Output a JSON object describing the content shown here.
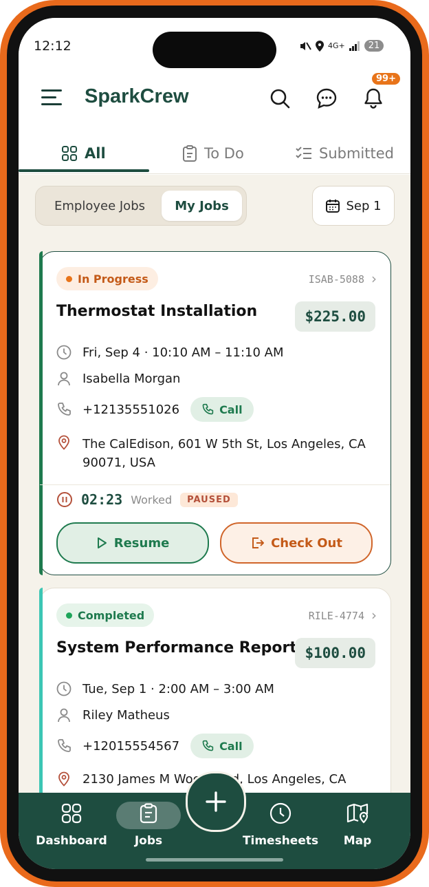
{
  "status_bar": {
    "time": "12:12",
    "network": "4G+",
    "battery": "21"
  },
  "app": {
    "title": "SparkCrew",
    "notification_count": "99+"
  },
  "tabs": [
    {
      "label": "All",
      "icon": "grid-icon",
      "active": true
    },
    {
      "label": "To Do",
      "icon": "clipboard-icon",
      "active": false
    },
    {
      "label": "Submitted",
      "icon": "checklist-icon",
      "active": false
    }
  ],
  "filter": {
    "segments": [
      {
        "label": "Employee Jobs",
        "active": false
      },
      {
        "label": "My Jobs",
        "active": true
      }
    ],
    "date_label": "Sep 1"
  },
  "jobs": [
    {
      "status": "In Progress",
      "job_id": "ISAB-5088",
      "title": "Thermostat Installation",
      "price": "$225.00",
      "datetime": "Fri, Sep 4 · 10:10 AM – 11:10 AM",
      "customer": "Isabella Morgan",
      "phone": "+12135551026",
      "call_label": "Call",
      "address_line1": "The CalEdison, 601 W 5th St, Los Angeles, CA",
      "address_line2": "90071, USA",
      "timer": "02:23",
      "timer_label": "Worked",
      "timer_state": "PAUSED",
      "resume_label": "Resume",
      "checkout_label": "Check Out"
    },
    {
      "status": "Completed",
      "job_id": "RILE-4774",
      "title": "System Performance Report",
      "price": "$100.00",
      "datetime": "Tue, Sep 1 · 2:00 AM – 3:00 AM",
      "customer": "Riley Matheus",
      "phone": "+12015554567",
      "call_label": "Call",
      "address_line1": "2130 James M Wood Blvd, Los Angeles, CA"
    }
  ],
  "bottom_nav": [
    {
      "label": "Dashboard",
      "icon": "dashboard-icon"
    },
    {
      "label": "Jobs",
      "icon": "clipboard-icon",
      "active": true
    },
    {
      "label": "Timesheets",
      "icon": "clock-icon"
    },
    {
      "label": "Map",
      "icon": "map-icon"
    }
  ],
  "colors": {
    "brand": "#1e4d40",
    "accent": "#e8741a",
    "frame": "#e96a1c"
  }
}
